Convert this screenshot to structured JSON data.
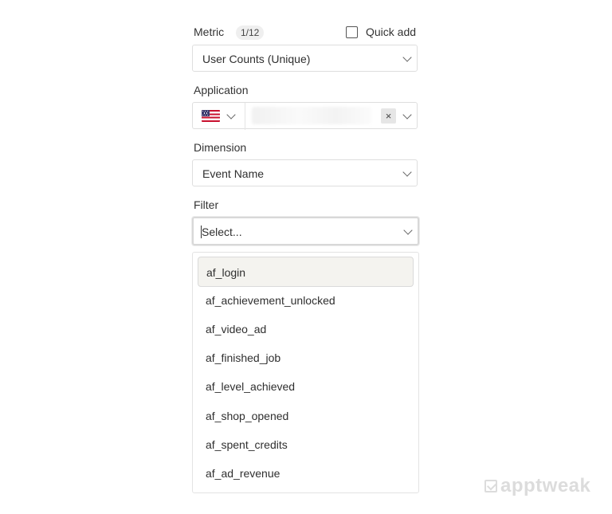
{
  "metric": {
    "label": "Metric",
    "badge": "1/12",
    "quick_add_label": "Quick add",
    "quick_add_checked": false,
    "value": "User Counts (Unique)"
  },
  "application": {
    "label": "Application",
    "country_flag": "us-flag-icon",
    "clear_label": "×"
  },
  "dimension": {
    "label": "Dimension",
    "value": "Event Name"
  },
  "filter": {
    "label": "Filter",
    "placeholder": "Select...",
    "options": [
      "af_login",
      "af_achievement_unlocked",
      "af_video_ad",
      "af_finished_job",
      "af_level_achieved",
      "af_shop_opened",
      "af_spent_credits",
      "af_ad_revenue"
    ],
    "highlighted_option": "af_login"
  },
  "watermark": {
    "text": "apptweak"
  },
  "colors": {
    "border": "#dedede",
    "highlight": "#f4f3ef",
    "text": "#2f2f2f"
  }
}
